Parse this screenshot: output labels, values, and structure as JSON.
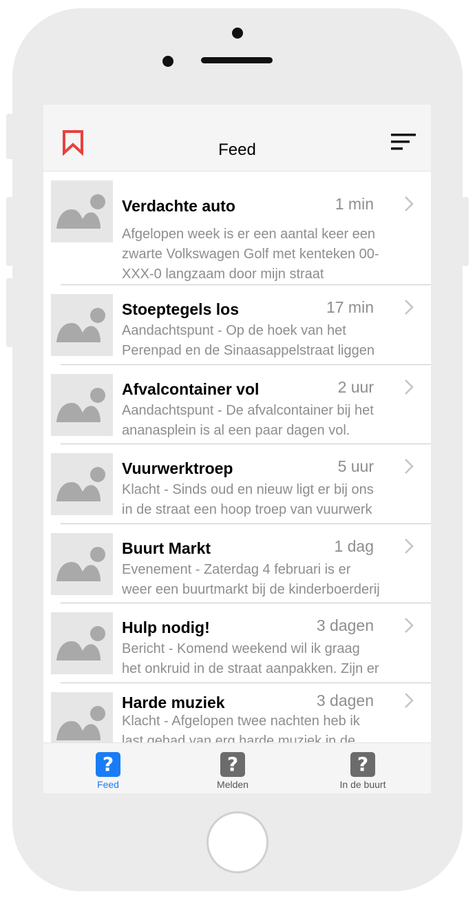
{
  "navbar": {
    "title": "Feed",
    "bookmark_icon": "bookmark-icon",
    "menu_icon": "filter-lines-icon",
    "accent_color": "#e8413c"
  },
  "feed": [
    {
      "title": "Verdachte auto",
      "time": "1 min",
      "lines": [
        "Afgelopen week is er een aantal keer een",
        "zwarte Volkswagen Golf met kenteken 00-",
        "XXX-0 langzaam door mijn straat"
      ]
    },
    {
      "title": "Stoeptegels los",
      "time": "17 min",
      "lines": [
        "Aandachtspunt - Op de hoek van het",
        "Perenpad en de Sinaasappelstraat liggen"
      ]
    },
    {
      "title": "Afvalcontainer vol",
      "time": "2 uur",
      "lines": [
        "Aandachtspunt - De afvalcontainer bij het",
        "ananasplein is al een paar dagen vol."
      ]
    },
    {
      "title": "Vuurwerktroep",
      "time": "5 uur",
      "lines": [
        "Klacht - Sinds oud en nieuw ligt er bij ons",
        "in de straat een hoop troep van vuurwerk"
      ]
    },
    {
      "title": "Buurt Markt",
      "time": "1 dag",
      "lines": [
        "Evenement - Zaterdag 4 februari is er",
        "weer een buurtmarkt bij de kinderboerderij"
      ]
    },
    {
      "title": "Hulp nodig!",
      "time": "3 dagen",
      "lines": [
        "Bericht - Komend weekend wil ik graag",
        "het onkruid in de straat aanpakken. Zijn er"
      ]
    },
    {
      "title": "Harde muziek",
      "time": "3 dagen",
      "lines": [
        "Klacht - Afgelopen twee nachten heb ik",
        "last gehad van erg harde muziek in de"
      ]
    }
  ],
  "tabbar": {
    "active_color": "#1a7cf5",
    "inactive_color": "#6b6b6b",
    "tabs": [
      {
        "label": "Feed",
        "icon": "question-icon",
        "active": true
      },
      {
        "label": "Melden",
        "icon": "question-icon",
        "active": false
      },
      {
        "label": "In de buurt",
        "icon": "question-icon",
        "active": false
      }
    ]
  }
}
